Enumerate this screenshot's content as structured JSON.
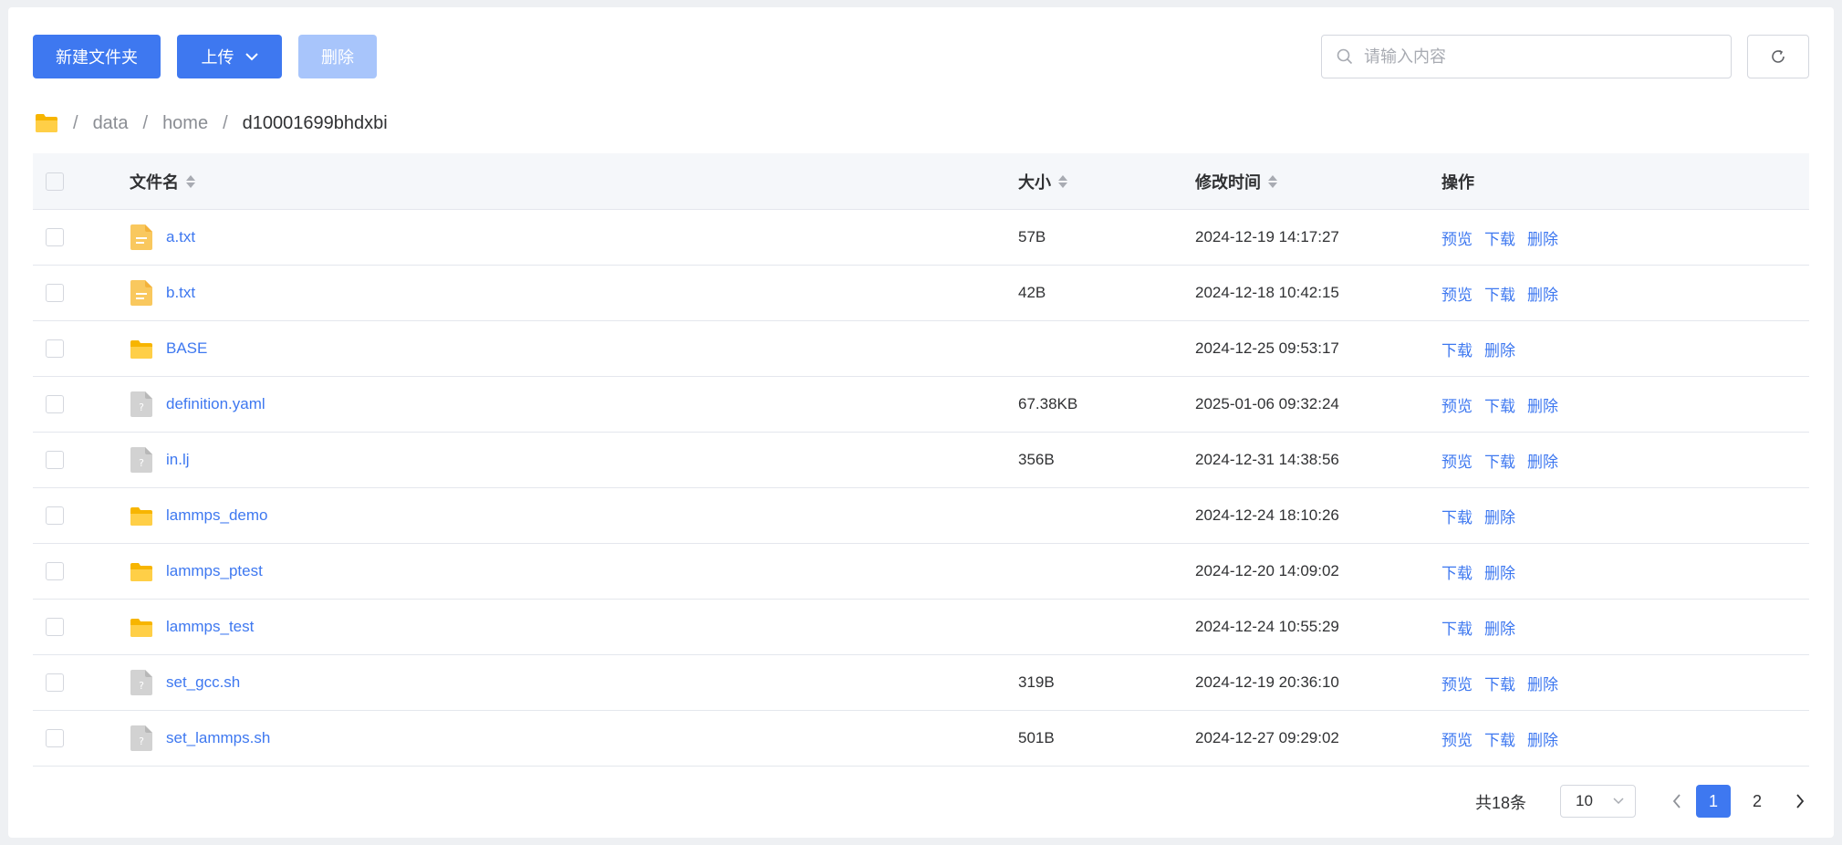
{
  "toolbar": {
    "new_folder_label": "新建文件夹",
    "upload_label": "上传",
    "delete_label": "删除",
    "search_placeholder": "请输入内容"
  },
  "breadcrumb": {
    "items": [
      "data",
      "home"
    ],
    "current": "d10001699bhdxbi"
  },
  "table": {
    "columns": {
      "name": "文件名",
      "size": "大小",
      "modified": "修改时间",
      "actions": "操作"
    },
    "rows": [
      {
        "name": "a.txt",
        "type": "text",
        "size": "57B",
        "modified": "2024-12-19 14:17:27",
        "actions": [
          "预览",
          "下载",
          "删除"
        ]
      },
      {
        "name": "b.txt",
        "type": "text",
        "size": "42B",
        "modified": "2024-12-18 10:42:15",
        "actions": [
          "预览",
          "下载",
          "删除"
        ]
      },
      {
        "name": "BASE",
        "type": "folder",
        "size": "",
        "modified": "2024-12-25 09:53:17",
        "actions": [
          "下载",
          "删除"
        ]
      },
      {
        "name": "definition.yaml",
        "type": "unknown",
        "size": "67.38KB",
        "modified": "2025-01-06 09:32:24",
        "actions": [
          "预览",
          "下载",
          "删除"
        ]
      },
      {
        "name": "in.lj",
        "type": "unknown",
        "size": "356B",
        "modified": "2024-12-31 14:38:56",
        "actions": [
          "预览",
          "下载",
          "删除"
        ]
      },
      {
        "name": "lammps_demo",
        "type": "folder",
        "size": "",
        "modified": "2024-12-24 18:10:26",
        "actions": [
          "下载",
          "删除"
        ]
      },
      {
        "name": "lammps_ptest",
        "type": "folder",
        "size": "",
        "modified": "2024-12-20 14:09:02",
        "actions": [
          "下载",
          "删除"
        ]
      },
      {
        "name": "lammps_test",
        "type": "folder",
        "size": "",
        "modified": "2024-12-24 10:55:29",
        "actions": [
          "下载",
          "删除"
        ]
      },
      {
        "name": "set_gcc.sh",
        "type": "unknown",
        "size": "319B",
        "modified": "2024-12-19 20:36:10",
        "actions": [
          "预览",
          "下载",
          "删除"
        ]
      },
      {
        "name": "set_lammps.sh",
        "type": "unknown",
        "size": "501B",
        "modified": "2024-12-27 09:29:02",
        "actions": [
          "预览",
          "下载",
          "删除"
        ]
      }
    ]
  },
  "pagination": {
    "total_label": "共18条",
    "page_size": "10",
    "pages": [
      "1",
      "2"
    ],
    "current_page": "1"
  },
  "colors": {
    "primary": "#3e78f0",
    "primary_disabled": "#a8c5fb",
    "folder": "#ffc53d",
    "text_file": "#f5c05a",
    "unknown_file": "#c9c9c9"
  }
}
